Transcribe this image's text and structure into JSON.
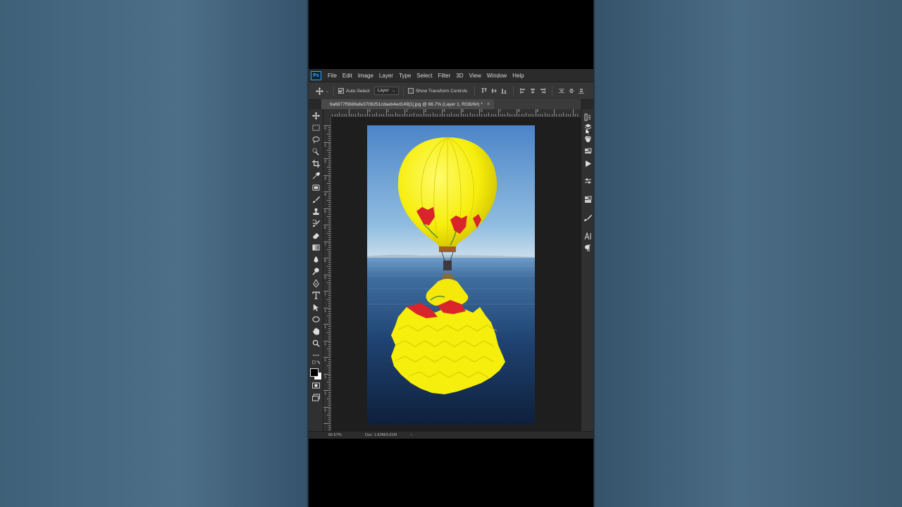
{
  "app": {
    "logo_text": "Ps",
    "menu": [
      "File",
      "Edit",
      "Image",
      "Layer",
      "Type",
      "Select",
      "Filter",
      "3D",
      "View",
      "Window",
      "Help"
    ]
  },
  "options": {
    "auto_select_label": "Auto-Select",
    "auto_select_checked": true,
    "layer_dropdown_value": "Layer",
    "transform_controls_label": "Show Transform Controls",
    "transform_controls_checked": false
  },
  "document": {
    "tab_title": "6a6877f5688afe3709251cdaeb4ed149[1].jpg @ 66.7% (Layer 1, RGB/8#) *",
    "close_glyph": "×"
  },
  "rulers": {
    "horizontal_labels": [
      "0",
      "1",
      "2",
      "3",
      "4",
      "5",
      "6",
      "7",
      "8",
      "9"
    ],
    "vertical_labels": [
      "0",
      "1",
      "2",
      "3",
      "4",
      "5",
      "6",
      "7",
      "8",
      "9",
      "1",
      "1",
      "1",
      "1",
      "1",
      "1",
      "1",
      "1"
    ]
  },
  "status": {
    "zoom": "66.67%",
    "doc_size": "Doc: 1.62M/3.01M",
    "arrow_glyph": "›"
  },
  "colors": {
    "ps_accent": "#31a8ff",
    "balloon_yellow": "#f6ee0c",
    "tulip_red": "#d8242a",
    "sky_top": "#4b84c8",
    "water_deep": "#0e1f3a"
  },
  "tools": [
    "move-tool-icon",
    "marquee-tool-icon",
    "lasso-tool-icon",
    "quick-select-tool-icon",
    "crop-tool-icon",
    "eyedropper-tool-icon",
    "frame-tool-icon",
    "brush-tool-icon",
    "stamp-tool-icon",
    "history-brush-tool-icon",
    "eraser-tool-icon",
    "gradient-tool-icon",
    "blur-tool-icon",
    "dodge-tool-icon",
    "pen-tool-icon",
    "type-tool-icon",
    "path-select-tool-icon",
    "ellipse-tool-icon",
    "hand-tool-icon",
    "zoom-tool-icon",
    "more-tools-icon",
    "swap-colors-icon",
    "color-swatches",
    "quick-mask-icon",
    "screen-mode-icon"
  ],
  "panels": [
    "history-panel-icon",
    "layers-panel-icon",
    "channels-panel-icon",
    "libraries-panel-icon",
    "actions-panel-icon",
    "properties-panel-icon",
    "adjustments-panel-icon",
    "brush-panel-icon",
    "character-panel-icon",
    "paragraph-panel-icon"
  ]
}
